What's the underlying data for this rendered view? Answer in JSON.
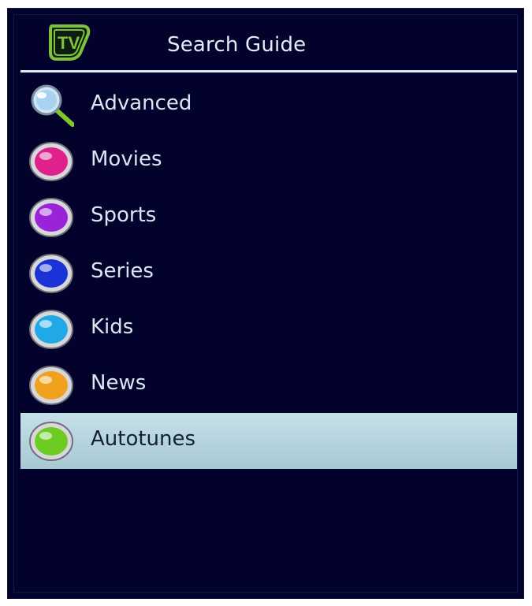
{
  "header": {
    "title": "Search Guide",
    "logo_text": "TV",
    "logo_color": "#7ec23a"
  },
  "menu": {
    "items": [
      {
        "label": "Advanced",
        "icon": "magnifier-icon",
        "color": "#b9dcf4",
        "selected": false
      },
      {
        "label": "Movies",
        "icon": "pink-button-icon",
        "color": "#e0208c",
        "selected": false
      },
      {
        "label": "Sports",
        "icon": "purple-button-icon",
        "color": "#9a22d8",
        "selected": false
      },
      {
        "label": "Series",
        "icon": "blue-button-icon",
        "color": "#1a32d6",
        "selected": false
      },
      {
        "label": "Kids",
        "icon": "cyan-button-icon",
        "color": "#21a8e6",
        "selected": false
      },
      {
        "label": "News",
        "icon": "orange-button-icon",
        "color": "#f0a21e",
        "selected": false
      },
      {
        "label": "Autotunes",
        "icon": "green-button-icon",
        "color": "#6ccc22",
        "selected": true
      }
    ]
  },
  "theme": {
    "background": "#02022c",
    "divider": "#d8eef4",
    "selected_bg": "#b8d6e0"
  }
}
